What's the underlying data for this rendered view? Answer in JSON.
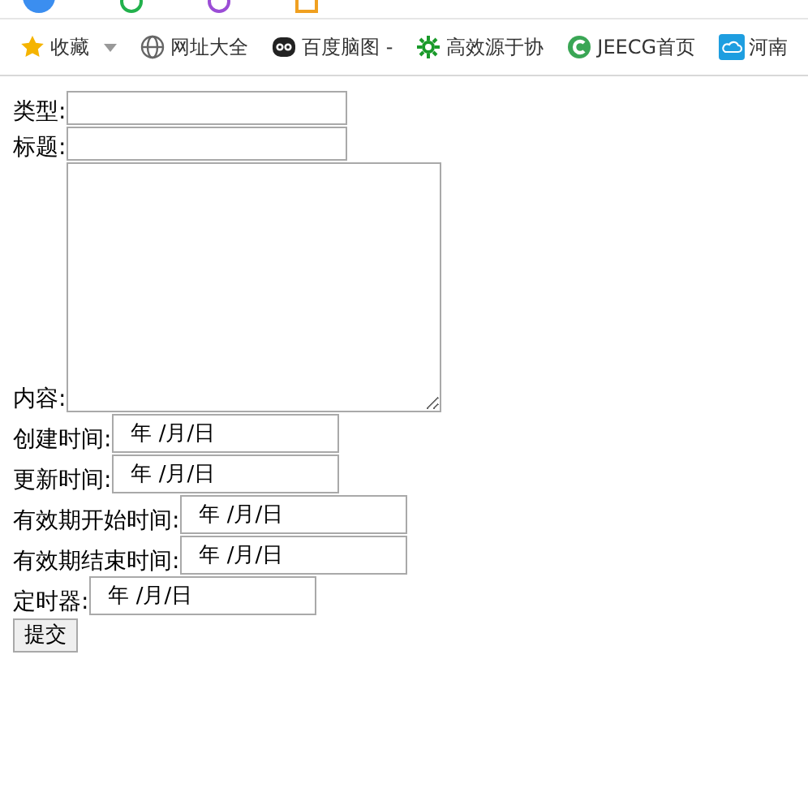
{
  "bookmarks": [
    {
      "kind": "star",
      "label": "收藏",
      "dropdown": true
    },
    {
      "kind": "globe",
      "label": "网址大全",
      "dropdown": false
    },
    {
      "kind": "owl",
      "label": "百度脑图 -",
      "dropdown": false
    },
    {
      "kind": "gear",
      "label": "高效源于协",
      "dropdown": false
    },
    {
      "kind": "c",
      "label": "JEECG首页",
      "dropdown": false
    },
    {
      "kind": "cloud",
      "label": "河南",
      "dropdown": false
    }
  ],
  "form": {
    "fields": [
      {
        "kind": "text",
        "label": "类型:"
      },
      {
        "kind": "text",
        "label": "标题:"
      },
      {
        "kind": "textarea",
        "label": "内容:"
      },
      {
        "kind": "date",
        "label": "创建时间:",
        "value": "年 /月/日"
      },
      {
        "kind": "date",
        "label": "更新时间:",
        "value": "年 /月/日"
      },
      {
        "kind": "date",
        "label": "有效期开始时间:",
        "value": "年 /月/日"
      },
      {
        "kind": "date",
        "label": "有效期结束时间:",
        "value": "年 /月/日"
      },
      {
        "kind": "date",
        "label": "定时器:",
        "value": "年 /月/日"
      }
    ],
    "submit": "提交"
  }
}
